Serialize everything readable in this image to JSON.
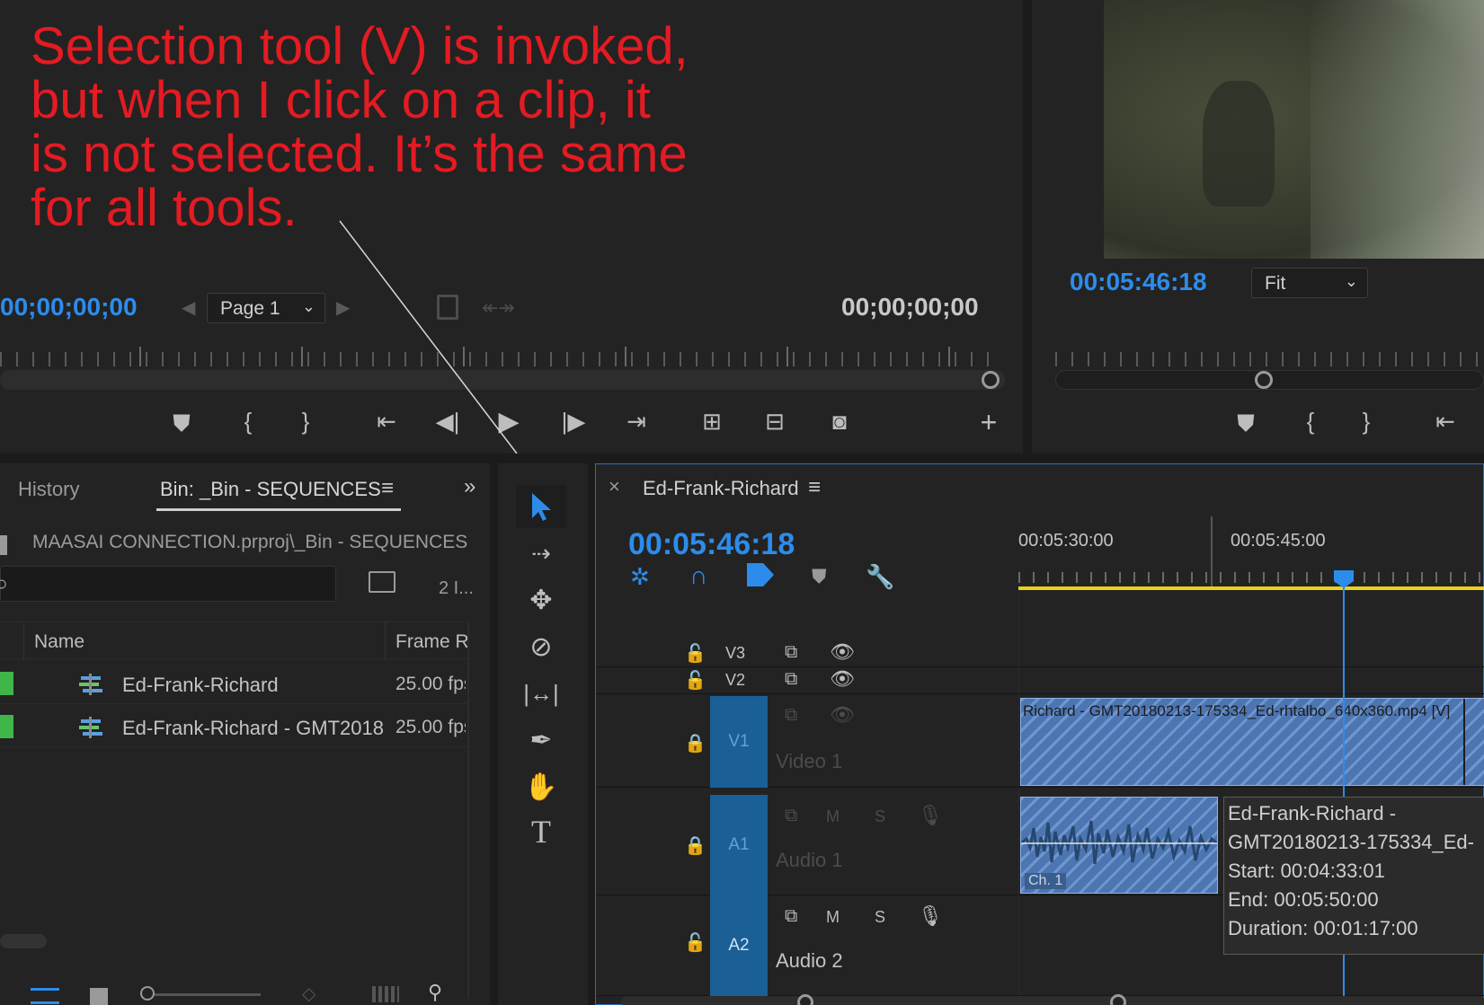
{
  "annotation": {
    "lines": [
      "Selection tool (V) is invoked,",
      "but when I click on a clip, it",
      "is not selected.  It’s the same",
      "for all tools."
    ],
    "color": "#e31b23"
  },
  "source_monitor": {
    "timecode_in": "00;00;00;00",
    "timecode_out": "00;00;00;00",
    "page_select": "Page 1"
  },
  "program_monitor": {
    "timecode": "00:05:46:18",
    "zoom_select": "Fit"
  },
  "project_panel": {
    "tabs": [
      "History",
      "Bin: _Bin - SEQUENCES"
    ],
    "active_tab_index": 1,
    "path": "MAASAI CONNECTION.prproj\\_Bin - SEQUENCES",
    "items_count": "2 I...",
    "columns": [
      "Name",
      "Frame R"
    ],
    "rows": [
      {
        "name": "Ed-Frank-Richard",
        "frame_rate": "25.00 fps"
      },
      {
        "name": "Ed-Frank-Richard - GMT2018",
        "frame_rate": "25.00 fps"
      }
    ]
  },
  "tools": {
    "active": "selection-tool",
    "items": [
      "selection",
      "track-select-forward",
      "ripple-edit",
      "razor",
      "slip",
      "pen",
      "hand",
      "type"
    ]
  },
  "timeline": {
    "sequence_name": "Ed-Frank-Richard",
    "timecode": "00:05:46:18",
    "ruler_labels": [
      "00:05:30:00",
      "00:05:45:00"
    ],
    "tracks": {
      "v3": "V3",
      "v2": "V2",
      "v1": "V1",
      "video1": "Video 1",
      "a1": "A1",
      "audio1": "Audio 1",
      "a2": "A2",
      "audio2": "Audio 2",
      "mute": "M",
      "solo": "S"
    },
    "clip_label": "Richard - GMT20180213-175334_Ed-rhtalbo_640x360.mp4 [V]",
    "channel_badge": "Ch. 1",
    "tooltip": [
      "Ed-Frank-Richard -",
      "GMT20180213-175334_Ed-",
      "Start: 00:04:33:01",
      "End: 00:05:50:00",
      "Duration: 00:01:17:00"
    ]
  },
  "colors": {
    "accent_blue": "#2d8ceb",
    "track_target": "#1a5f95",
    "clip_blue": "#5a80bb",
    "work_area_yellow": "#e8d21d",
    "label_green": "#3fb54a"
  }
}
